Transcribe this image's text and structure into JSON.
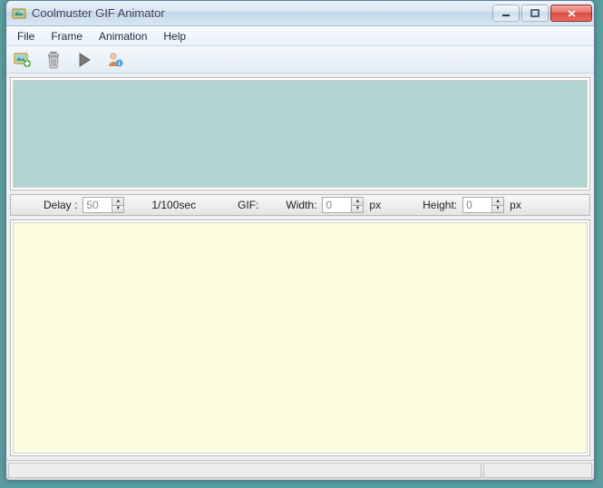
{
  "window": {
    "title": "Coolmuster GIF Animator"
  },
  "menu": {
    "file": "File",
    "frame": "Frame",
    "animation": "Animation",
    "help": "Help"
  },
  "params": {
    "delay_label": "Delay :",
    "delay_value": "50",
    "delay_unit": "1/100sec",
    "gif_label": "GIF:",
    "width_label": "Width:",
    "width_value": "0",
    "px_label": "px",
    "height_label": "Height:",
    "height_value": "0"
  }
}
